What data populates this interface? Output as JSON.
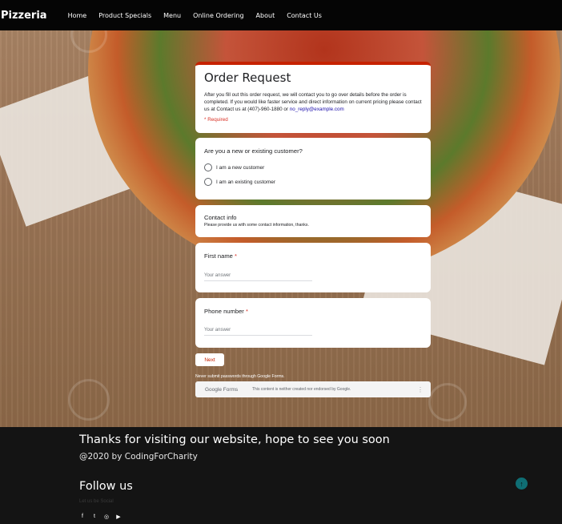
{
  "nav": {
    "brand": "Pizzeria",
    "links": [
      "Home",
      "Product Specials",
      "Menu",
      "Online Ordering",
      "About",
      "Contact Us"
    ]
  },
  "form": {
    "title": "Order Request",
    "description": "After you fill out this order request, we will contact you to go over details before the order is completed. If you would like faster service and direct information on current pricing please contact us at Contact us at (407)-960-1880 or ",
    "email_link": "no_reply@example.com",
    "required_note": "* Required",
    "customer_question": "Are you a new or existing customer?",
    "options": [
      "I am a new customer",
      "I am an existing customer"
    ],
    "contact_title": "Contact info",
    "contact_subtitle": "Please provide us with some contact information, thanks.",
    "first_name_label": "First name",
    "phone_label": "Phone number",
    "required_star": "*",
    "answer_placeholder": "Your answer",
    "next_label": "Next",
    "password_warning": "Never submit passwords through Google Forms.",
    "gf_logo": "Google Forms",
    "gf_disclaimer": "This content is neither created nor endorsed by Google.",
    "gf_menu": "⋮"
  },
  "footer": {
    "thanks": "Thanks for visiting our website, hope to see you soon",
    "credit": "@2020 by CodingForCharity",
    "follow_title": "Follow us",
    "social_tagline": "Let us be Social",
    "social_icons": [
      "f",
      "t",
      "◎",
      "▶"
    ],
    "back_to_top": "↑"
  },
  "colors": {
    "accent": "#c62200",
    "required": "#d93025",
    "teal": "#0f6e74"
  }
}
